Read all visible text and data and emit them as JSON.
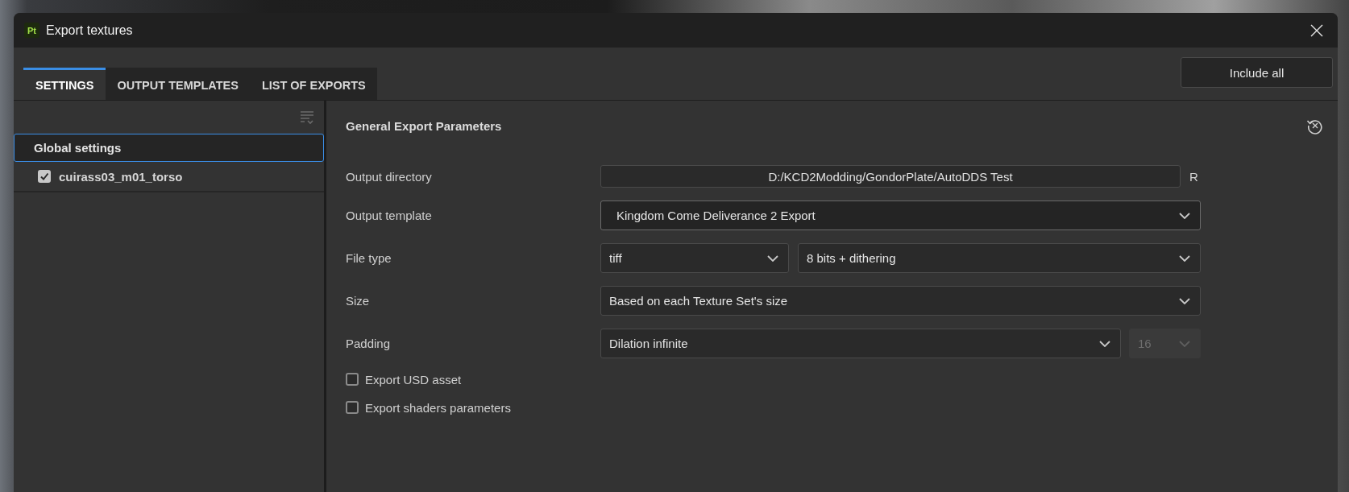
{
  "window": {
    "title": "Export textures",
    "app_badge": "Pt"
  },
  "tabs": [
    {
      "label": "SETTINGS",
      "selected": true
    },
    {
      "label": "OUTPUT TEMPLATES",
      "selected": false
    },
    {
      "label": "LIST OF EXPORTS",
      "selected": false
    }
  ],
  "include_all_button": "Include all",
  "sidebar": {
    "items": [
      {
        "kind": "header",
        "label": "Global settings",
        "selected": true
      },
      {
        "kind": "checkbox",
        "label": "cuirass03_m01_torso",
        "checked": true,
        "selected": false
      }
    ]
  },
  "panel": {
    "title": "General Export Parameters",
    "rows": [
      {
        "kind": "path",
        "label": "Output directory",
        "value": "D:/KCD2Modding/GondorPlate/AutoDDS Test",
        "suffix": "R"
      },
      {
        "kind": "select",
        "label": "Output template",
        "fields": [
          {
            "value": "Kingdom Come Deliverance 2 Export",
            "focused": true,
            "disabled": false
          }
        ]
      },
      {
        "kind": "select-pair",
        "label": "File type",
        "fields": [
          {
            "value": "tiff",
            "focused": false,
            "disabled": false
          },
          {
            "value": "8 bits + dithering",
            "focused": false,
            "disabled": false
          }
        ]
      },
      {
        "kind": "select",
        "label": "Size",
        "fields": [
          {
            "value": "Based on each Texture Set's size",
            "focused": false,
            "disabled": false
          }
        ]
      },
      {
        "kind": "select-count",
        "label": "Padding",
        "fields": [
          {
            "value": "Dilation infinite",
            "focused": false,
            "disabled": false
          },
          {
            "value": "16",
            "focused": false,
            "disabled": true
          }
        ]
      }
    ],
    "options": [
      {
        "label": "Export USD asset",
        "checked": false
      },
      {
        "label": "Export shaders parameters",
        "checked": false
      }
    ]
  }
}
